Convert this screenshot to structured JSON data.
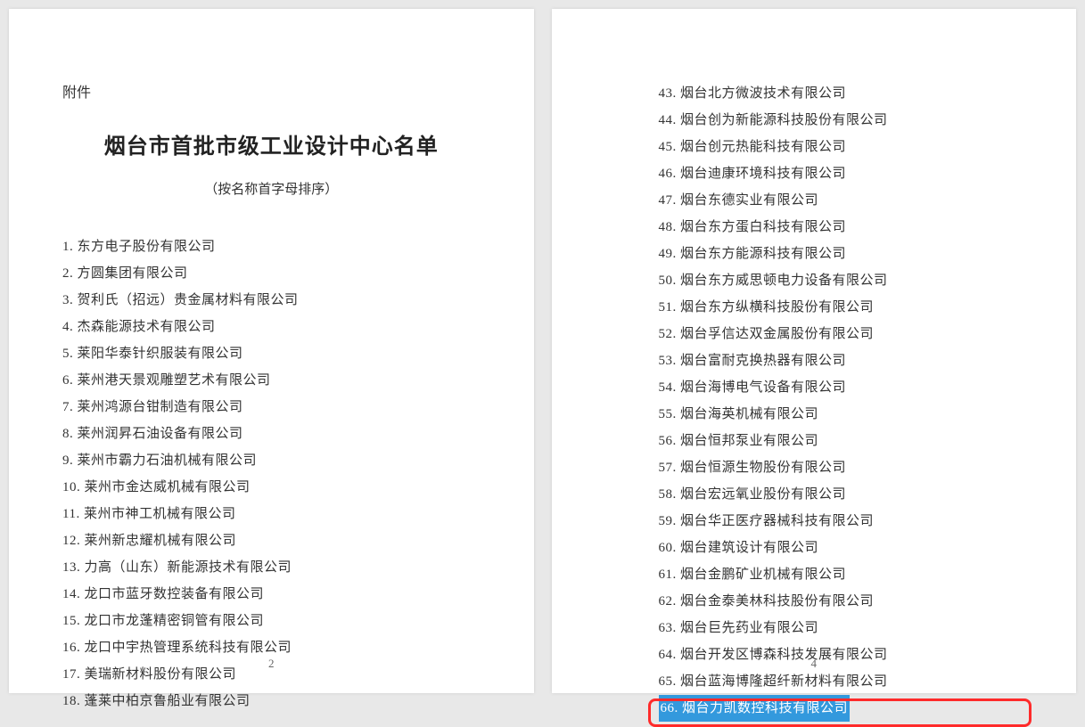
{
  "attachment_label": "附件",
  "title": "烟台市首批市级工业设计中心名单",
  "subtitle": "（按名称首字母排序）",
  "page_number_left": "2",
  "page_number_right": "4",
  "left_items": [
    "1. 东方电子股份有限公司",
    "2. 方圆集团有限公司",
    "3. 贺利氏（招远）贵金属材料有限公司",
    "4. 杰森能源技术有限公司",
    "5. 莱阳华泰针织服装有限公司",
    "6. 莱州港天景观雕塑艺术有限公司",
    "7. 莱州鸿源台钳制造有限公司",
    "8. 莱州润昇石油设备有限公司",
    "9. 莱州市霸力石油机械有限公司",
    "10. 莱州市金达威机械有限公司",
    "11. 莱州市神工机械有限公司",
    "12. 莱州新忠耀机械有限公司",
    "13. 力高（山东）新能源技术有限公司",
    "14. 龙口市蓝牙数控装备有限公司",
    "15. 龙口市龙蓬精密铜管有限公司",
    "16. 龙口中宇热管理系统科技有限公司",
    "17. 美瑞新材料股份有限公司",
    "18. 蓬莱中柏京鲁船业有限公司"
  ],
  "right_items": [
    "43. 烟台北方微波技术有限公司",
    "44. 烟台创为新能源科技股份有限公司",
    "45. 烟台创元热能科技有限公司",
    "46. 烟台迪康环境科技有限公司",
    "47. 烟台东德实业有限公司",
    "48. 烟台东方蛋白科技有限公司",
    "49. 烟台东方能源科技有限公司",
    "50. 烟台东方威思顿电力设备有限公司",
    "51. 烟台东方纵横科技股份有限公司",
    "52. 烟台孚信达双金属股份有限公司",
    "53. 烟台富耐克换热器有限公司",
    "54. 烟台海博电气设备有限公司",
    "55. 烟台海英机械有限公司",
    "56. 烟台恒邦泵业有限公司",
    "57. 烟台恒源生物股份有限公司",
    "58. 烟台宏远氧业股份有限公司",
    "59. 烟台华正医疗器械科技有限公司",
    "60. 烟台建筑设计有限公司",
    "61. 烟台金鹏矿业机械有限公司",
    "62. 烟台金泰美林科技股份有限公司",
    "63. 烟台巨先药业有限公司",
    "64. 烟台开发区博森科技发展有限公司",
    "65. 烟台蓝海博隆超纤新材料有限公司"
  ],
  "highlighted_item": "66. 烟台力凯数控科技有限公司"
}
